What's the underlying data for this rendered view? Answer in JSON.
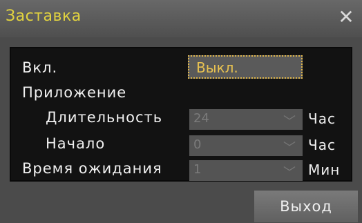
{
  "window": {
    "title": "Заставка",
    "close_icon": "✕"
  },
  "fields": {
    "enable": {
      "label": "Вкл.",
      "value": "Выкл."
    },
    "application": {
      "label": "Приложение"
    },
    "duration": {
      "label": "Длительность",
      "value": "24",
      "unit": "Час"
    },
    "start": {
      "label": "Начало",
      "value": "0",
      "unit": "Час"
    },
    "timeout": {
      "label": "Время ожидания",
      "value": "1",
      "unit": "Мин"
    }
  },
  "footer": {
    "exit_label": "Выход"
  }
}
